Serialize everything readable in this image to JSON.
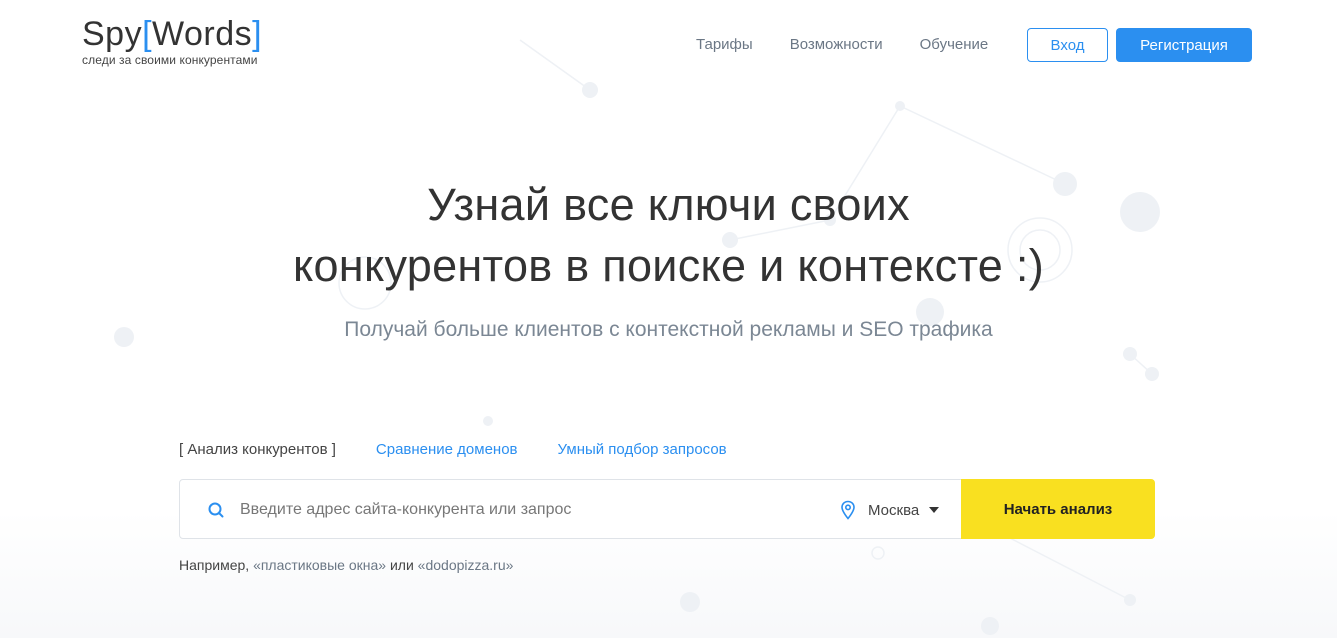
{
  "header": {
    "logo": {
      "prefix": "Spy",
      "bracket_open": "[",
      "word": "Words",
      "bracket_close": "]",
      "tagline": "следи за своими конкурентами"
    },
    "nav": [
      {
        "label": "Тарифы"
      },
      {
        "label": "Возможности"
      },
      {
        "label": "Обучение"
      }
    ],
    "login_label": "Вход",
    "register_label": "Регистрация"
  },
  "hero": {
    "title_line1": "Узнай все ключи своих",
    "title_line2": "конкурентов в поиске и контексте :)",
    "subtitle": "Получай больше клиентов с контекстной рекламы и SEO трафика"
  },
  "tabs": [
    {
      "label": "[ Анализ конкурентов ]",
      "active": true
    },
    {
      "label": "Сравнение доменов",
      "active": false
    },
    {
      "label": "Умный подбор запросов",
      "active": false
    }
  ],
  "search": {
    "placeholder": "Введите адрес сайта-конкурента или запрос",
    "value": "",
    "region": "Москва",
    "submit_label": "Начать анализ",
    "search_icon": "search-icon",
    "region_icon": "map-pin-icon"
  },
  "example": {
    "prefix": "Например, ",
    "link1": "«пластиковые окна»",
    "middle": " или ",
    "link2": "«dodopizza.ru»"
  },
  "colors": {
    "accent": "#2b8ff0",
    "cta": "#f9e020",
    "text": "#333333",
    "muted": "#7b8794"
  }
}
